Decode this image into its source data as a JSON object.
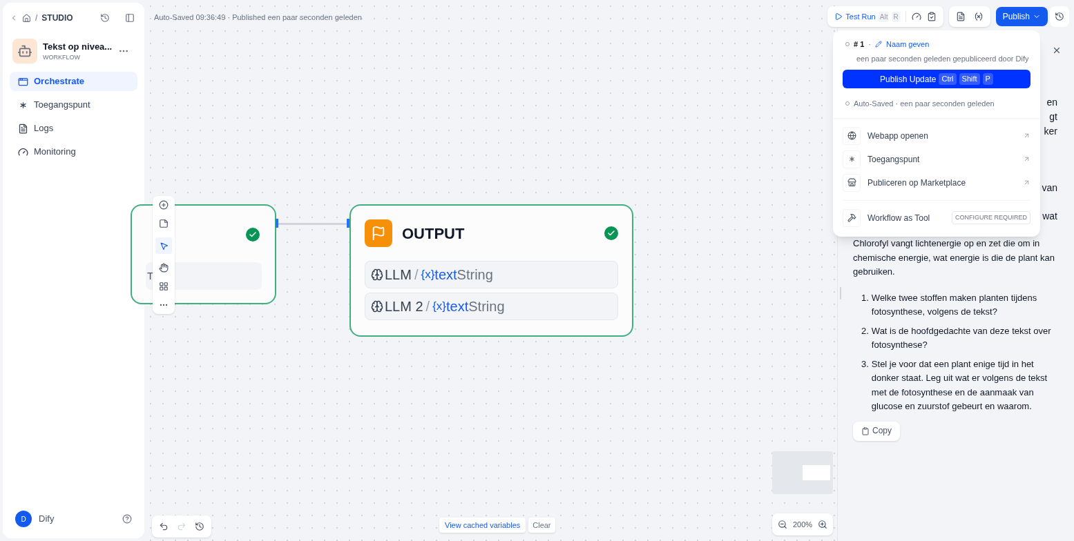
{
  "sidebar": {
    "separator": "/",
    "breadcrumb": "STUDIO",
    "app": {
      "name": "Tekst op nivea...",
      "type": "WORKFLOW"
    },
    "nav": [
      {
        "label": "Orchestrate",
        "selected": true
      },
      {
        "label": "Toegangspunt",
        "selected": false
      },
      {
        "label": "Logs",
        "selected": false
      },
      {
        "label": "Monitoring",
        "selected": false
      }
    ],
    "user": {
      "initial": "D",
      "name": "Dify"
    }
  },
  "status_text": "Auto-Saved 09:36:49 · Published een paar seconden geleden",
  "toolbar": {
    "test_run": {
      "label": "Test Run",
      "keys": [
        "Alt",
        "R"
      ]
    },
    "publish": "Publish"
  },
  "publish_menu": {
    "version": {
      "number": "# 1",
      "separator": "·",
      "name_link": "Naam geven",
      "meta": "een paar seconden geleden gepubliceerd door Dify"
    },
    "publish_update": {
      "label": "Publish Update",
      "keys": [
        "Ctrl",
        "Shift",
        "P"
      ]
    },
    "autosaved": "Auto-Saved · een paar seconden geleden",
    "actions": [
      {
        "label": "Webapp openen"
      },
      {
        "label": "Toegangspunt"
      },
      {
        "label": "Publiceren op Marketplace"
      }
    ],
    "tool": {
      "label": "Workflow as Tool",
      "badge": "CONFIGURE REQUIRED"
    }
  },
  "canvas": {
    "left_node": {
      "passed": true,
      "field_fragment": "T"
    },
    "output_node": {
      "title": "OUTPUT",
      "passed": true,
      "variables": [
        {
          "source": "LLM",
          "separator": "/",
          "marker": "{x}",
          "name": "text",
          "type": "String"
        },
        {
          "source": "LLM 2",
          "separator": "/",
          "marker": "{x}",
          "name": "text",
          "type": "String"
        }
      ]
    },
    "view_cached": "View cached variables",
    "clear": "Clear",
    "zoom": "200%"
  },
  "result_panel": {
    "fragments": [
      "en",
      "gt",
      "ker",
      "van",
      "wat"
    ],
    "paragraph": "Chlorofyl vangt lichtenergie op en zet die om in chemische energie, wat energie is die de plant kan gebruiken.",
    "questions": [
      {
        "number": "1.",
        "text": "Welke twee stoffen maken planten tijdens fotosynthese, volgens de tekst?"
      },
      {
        "number": "2.",
        "text": "Wat is de hoofdgedachte van deze tekst over fotosynthese?"
      },
      {
        "number": "3.",
        "text": "Stel je voor dat een plant enige tijd in het donker staat. Leg uit wat er volgens de tekst met de fotosynthese en de aanmaak van glucose en zuurstof gebeurt en waarom."
      }
    ],
    "copy": "Copy"
  }
}
